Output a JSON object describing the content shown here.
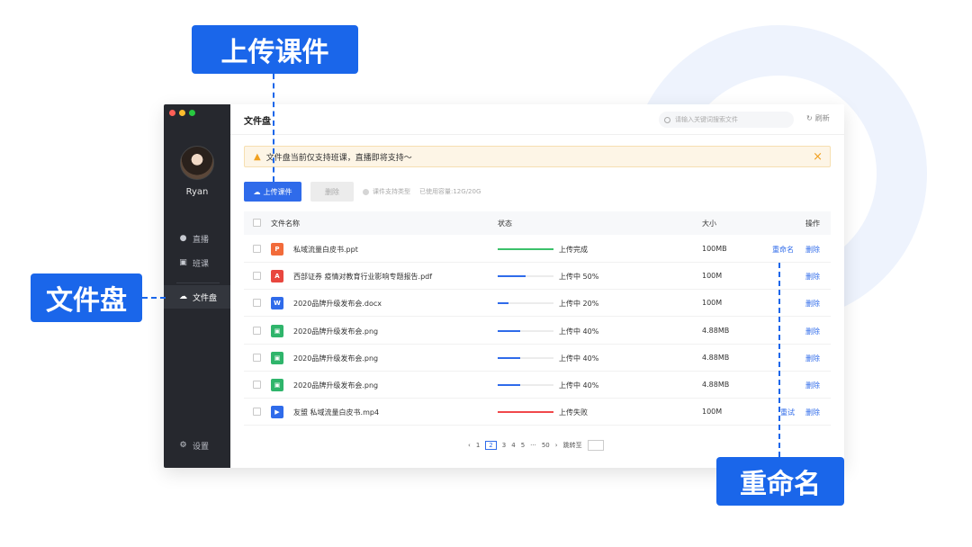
{
  "callouts": {
    "upload": "上传课件",
    "disk": "文件盘",
    "rename": "重命名"
  },
  "sidebar": {
    "username": "Ryan",
    "items": [
      {
        "label": "直播",
        "icon": "play-circle-icon"
      },
      {
        "label": "班课",
        "icon": "class-icon"
      },
      {
        "label": "文件盘",
        "icon": "cloud-icon"
      }
    ],
    "settings": "设置"
  },
  "header": {
    "title": "文件盘",
    "search_placeholder": "请输入关键词搜索文件",
    "refresh": "刷新"
  },
  "notice": {
    "text": "文件盘当前仅支持班课，直播即将支持～"
  },
  "toolbar": {
    "upload": "上传课件",
    "delete": "删除",
    "supported_types": "课件支持类型",
    "usage": "已使用容量:12G/20G"
  },
  "table": {
    "headers": {
      "name": "文件名称",
      "status": "状态",
      "size": "大小",
      "actions": "操作"
    },
    "rows": [
      {
        "name": "私域流量白皮书.ppt",
        "type": "P",
        "type_color": "#f26b3a",
        "status": "上传完成",
        "progress": 1.0,
        "bar_color": "#3bc16a",
        "size": "100MB",
        "rename": "重命名",
        "delete": "删除"
      },
      {
        "name": "西部证券 疫情对教育行业影响专题报告.pdf",
        "type": "A",
        "type_color": "#e8473f",
        "status": "上传中 50%",
        "progress": 0.5,
        "bar_color": "#2f6bea",
        "size": "100M",
        "delete": "删除"
      },
      {
        "name": "2020品牌升级发布会.docx",
        "type": "W",
        "type_color": "#2f6bea",
        "status": "上传中 20%",
        "progress": 0.2,
        "bar_color": "#2f6bea",
        "size": "100M",
        "delete": "删除"
      },
      {
        "name": "2020品牌升级发布会.png",
        "type": "▣",
        "type_color": "#2fb56b",
        "status": "上传中 40%",
        "progress": 0.4,
        "bar_color": "#2f6bea",
        "size": "4.88MB",
        "delete": "删除"
      },
      {
        "name": "2020品牌升级发布会.png",
        "type": "▣",
        "type_color": "#2fb56b",
        "status": "上传中 40%",
        "progress": 0.4,
        "bar_color": "#2f6bea",
        "size": "4.88MB",
        "delete": "删除"
      },
      {
        "name": "2020品牌升级发布会.png",
        "type": "▣",
        "type_color": "#2fb56b",
        "status": "上传中 40%",
        "progress": 0.4,
        "bar_color": "#2f6bea",
        "size": "4.88MB",
        "delete": "删除"
      },
      {
        "name": "友盟 私域流量白皮书.mp4",
        "type": "▶",
        "type_color": "#2f6bea",
        "status": "上传失败",
        "progress": 1.0,
        "bar_color": "#f0484b",
        "size": "100M",
        "retry": "重试",
        "delete": "删除"
      }
    ]
  },
  "pagination": {
    "prev": "‹",
    "pages": [
      "1",
      "2",
      "3",
      "4",
      "5"
    ],
    "current": "2",
    "ellipsis": "···",
    "last": "50",
    "next": "›",
    "jump_label": "跳转至"
  },
  "colors": {
    "accent": "#2f6bea",
    "callout": "#1a66ea",
    "sidebar": "#26282e",
    "success": "#3bc16a",
    "error": "#f0484b",
    "warning": "#f0a020"
  }
}
